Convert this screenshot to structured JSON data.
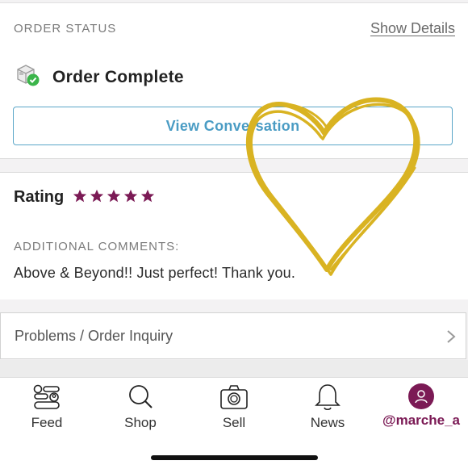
{
  "order_status": {
    "label": "ORDER STATUS",
    "show_details": "Show Details",
    "status_text": "Order Complete",
    "view_conversation": "View Conversation"
  },
  "rating": {
    "title": "Rating",
    "stars": 5,
    "max_stars": 5,
    "star_color": "#7b1a55",
    "comments_label": "ADDITIONAL COMMENTS:",
    "comment": "Above & Beyond!! Just perfect! Thank you."
  },
  "problems": {
    "label": "Problems / Order Inquiry"
  },
  "tabbar": {
    "tabs": [
      {
        "label": "Feed",
        "icon": "feed-icon"
      },
      {
        "label": "Shop",
        "icon": "search-icon"
      },
      {
        "label": "Sell",
        "icon": "camera-icon"
      },
      {
        "label": "News",
        "icon": "bell-icon"
      },
      {
        "label": "@marche_a",
        "icon": "avatar-icon"
      }
    ]
  },
  "colors": {
    "accent_blue": "#4a9cc4",
    "brand": "#7b1a55",
    "heart": "#d9b322",
    "success": "#3bb54a"
  }
}
